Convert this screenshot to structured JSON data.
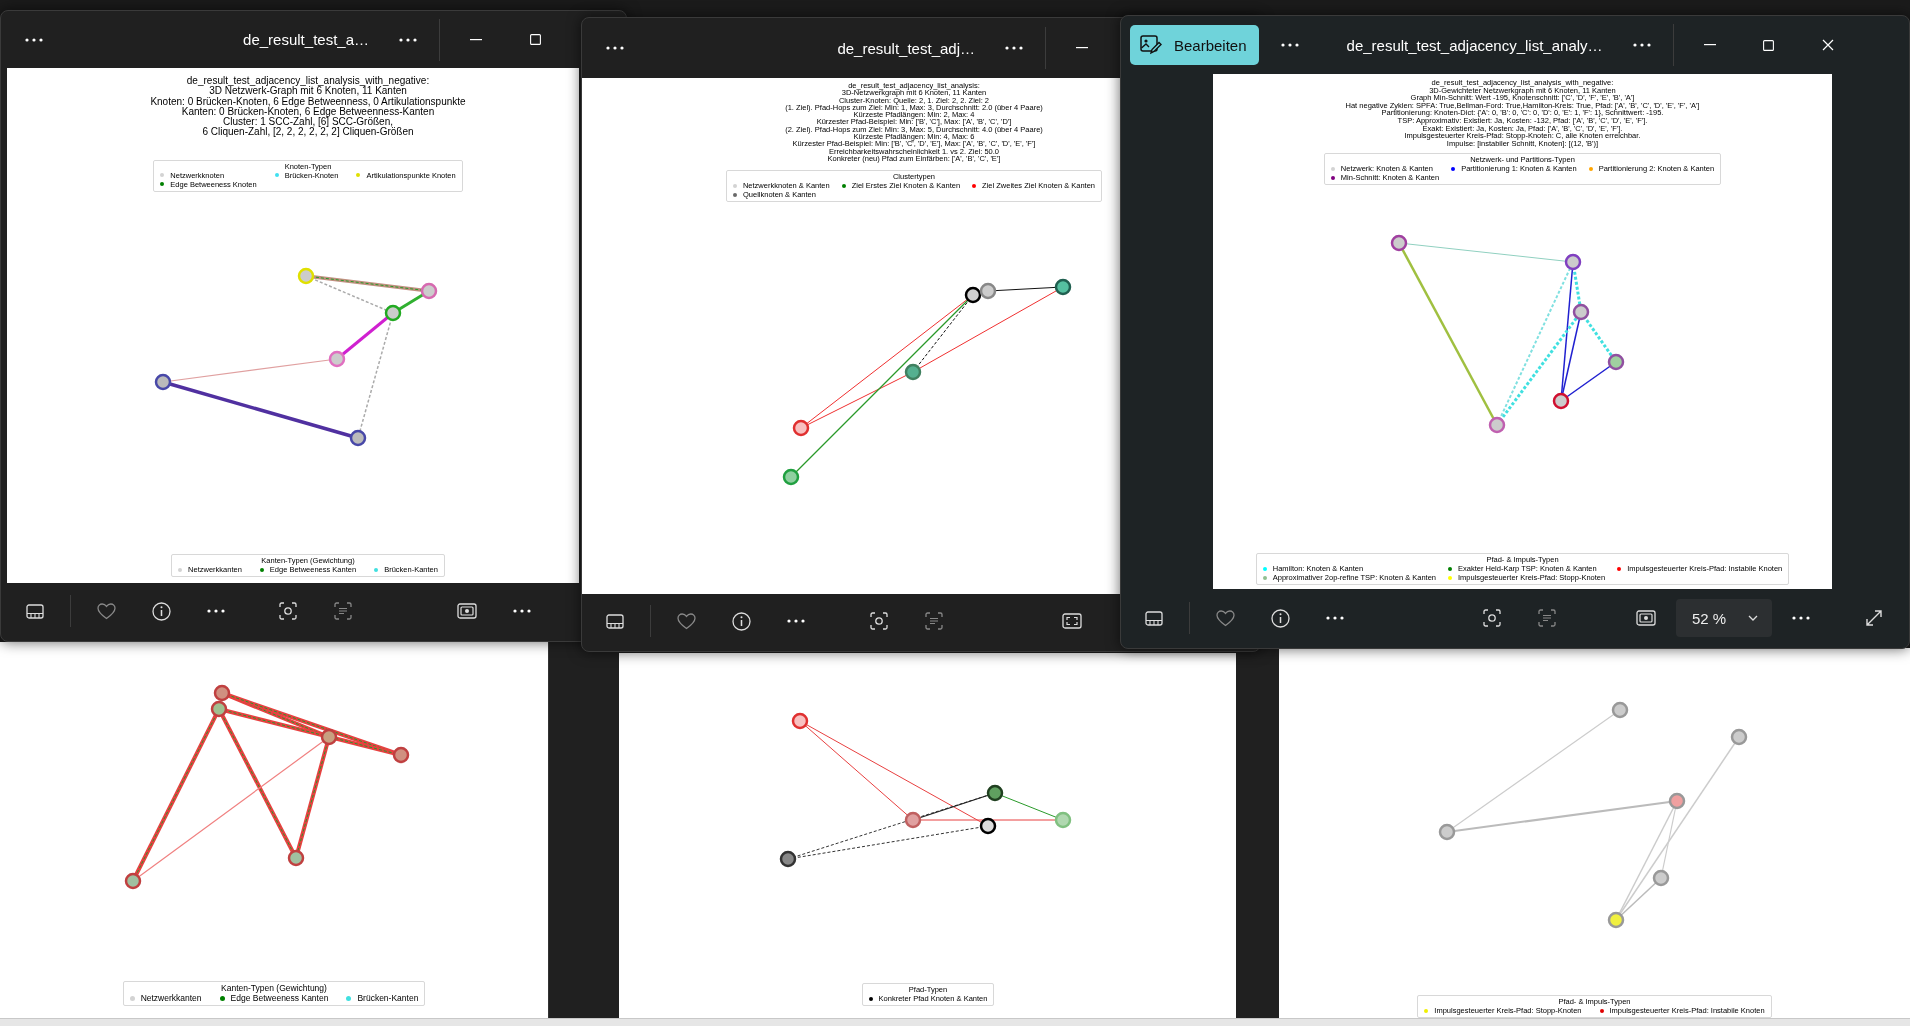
{
  "windows": [
    {
      "kind": "back",
      "menu": false,
      "figure": {
        "bottom_legend": {
          "title": "Kanten-Typen (Gewichtung)",
          "items": [
            {
              "label": "Netzwerkkanten",
              "color": "#d3d3d3"
            },
            {
              "label": "Edge Betweeness Kanten",
              "color": "#008000"
            },
            {
              "label": "Brücken-Kanten",
              "color": "#40e0e0"
            }
          ]
        }
      }
    },
    {
      "kind": "back",
      "menu": true,
      "figure": {
        "bottom_legend": {
          "title": "Pfad-Typen",
          "items": [
            {
              "label": "Konkreter Pfad Knoten & Kanten",
              "color": "#000000"
            }
          ]
        }
      }
    },
    {
      "kind": "back",
      "menu": false,
      "figure": {
        "bottom_legend": {
          "title": "Pfad- & Impuls-Typen",
          "items": [
            {
              "label": "Impulsgesteuerter Kreis-Pfad: Stopp-Knoten",
              "color": "#f0f000"
            },
            {
              "label": "Impulsgesteuerter Kreis-Pfad: Instabile Knoten",
              "color": "#e00000"
            }
          ]
        }
      }
    },
    {
      "kind": "front",
      "title": "de_result_test_a…",
      "controls": [
        {
          "kind": "minimize"
        },
        {
          "kind": "maximize"
        }
      ],
      "toolbar": [
        {
          "kind": "filmstrip"
        },
        {
          "kind": "divider"
        },
        {
          "kind": "heart"
        },
        {
          "kind": "info"
        },
        {
          "kind": "more"
        },
        {
          "kind": "scan"
        },
        {
          "kind": "textscan"
        },
        {
          "kind": "slideshow"
        },
        {
          "kind": "more"
        }
      ],
      "figure": {
        "title_lines": [
          "de_result_test_adjacency_list_analysis_with_negative:",
          "3D Netzwerk-Graph mit 6 Knoten, 11 Kanten",
          "Knoten: 0 Brücken-Knoten, 6 Edge Betweenness, 0 Artikulationspunkte",
          "Kanten: 0 Brücken-Knoten, 6 Edge Betweenness-Kanten",
          "Cluster: 1 SCC-Zahl, [6] SCC-Größen,",
          "6 Cliquen-Zahl, [2, 2, 2, 2, 2, 2] Cliquen-Größen"
        ],
        "top_legend": {
          "title": "Knoten-Typen",
          "items": [
            {
              "label": "Netzwerkknoten",
              "color": "#d3d3d3"
            },
            {
              "label": "Brücken-Knoten",
              "color": "#40e0f0"
            },
            {
              "label": "Artikulationspunkte Knoten",
              "color": "#e0e000"
            },
            {
              "label": "Edge Betweeness Knoten",
              "color": "#008000"
            }
          ]
        },
        "bottom_legend": {
          "title": "Kanten-Typen (Gewichtung)",
          "items": [
            {
              "label": "Netzwerkkanten",
              "color": "#d3d3d3"
            },
            {
              "label": "Edge Betweeness Kanten",
              "color": "#008000"
            },
            {
              "label": "Brücken-Kanten",
              "color": "#40e0e0"
            }
          ]
        }
      }
    },
    {
      "kind": "front",
      "title": "de_result_test_adj…",
      "controls": [
        {
          "kind": "minimize"
        }
      ],
      "toolbar": [
        {
          "kind": "filmstrip"
        },
        {
          "kind": "divider"
        },
        {
          "kind": "heart"
        },
        {
          "kind": "info"
        },
        {
          "kind": "more"
        },
        {
          "kind": "scan"
        },
        {
          "kind": "textscan"
        },
        {
          "kind": "fit"
        }
      ],
      "figure": {
        "title_lines": [
          "de_result_test_adjacency_list_analysis:",
          "3D-Netzwerkgraph mit 6 Knoten, 11 Kanten",
          "Cluster-Knoten: Quelle: 2, 1. Ziel: 2, 2. Ziel: 2",
          "(1. Ziel). Pfad-Hops zum Ziel: Min: 1, Max: 3, Durchschnitt: 2.0 (über 4 Paare)",
          "Kürzeste Pfadlängen: Min: 2, Max: 4",
          "Kürzester Pfad-Beispiel: Min: ['B', 'C'], Max: ['A', 'B', 'C', 'D']",
          "(2. Ziel). Pfad-Hops zum Ziel: Min: 3, Max: 5, Durchschnitt: 4.0 (über 4 Paare)",
          "Kürzeste Pfadlängen: Min: 4, Max: 6",
          "Kürzester Pfad-Beispiel: Min: ['B', 'C', 'D', 'E'], Max: ['A', 'B', 'C', 'D', 'E', 'F']",
          "Erreichbarkeitswahrscheinlichkeit 1. vs 2. Ziel: 50.0",
          "Konkreter (neu) Pfad zum Einfärben: ['A', 'B', 'C', 'E']"
        ],
        "top_legend": {
          "title": "Clustertypen",
          "items": [
            {
              "label": "Netzwerkknoten & Kanten",
              "color": "#d3d3d3"
            },
            {
              "label": "Ziel Erstes Ziel Knoten & Kanten",
              "color": "#008000"
            },
            {
              "label": "Ziel Zweites Ziel Knoten & Kanten",
              "color": "#ff0000"
            },
            {
              "label": "Quellknoten & Kanten",
              "color": "#696969"
            }
          ]
        }
      }
    },
    {
      "kind": "front",
      "title": "de_result_test_adjacency_list_analy…",
      "edit_button": "Bearbeiten",
      "controls": [
        {
          "kind": "minimize"
        },
        {
          "kind": "maximize"
        },
        {
          "kind": "close"
        }
      ],
      "toolbar": [
        {
          "kind": "filmstrip"
        },
        {
          "kind": "divider"
        },
        {
          "kind": "heart"
        },
        {
          "kind": "info"
        },
        {
          "kind": "more"
        },
        {
          "kind": "scan"
        },
        {
          "kind": "textscan"
        },
        {
          "kind": "slideshow"
        },
        {
          "kind": "zoom",
          "value": "52 %"
        },
        {
          "kind": "more"
        },
        {
          "kind": "expand"
        }
      ],
      "figure": {
        "title_lines": [
          "de_result_test_adjacency_list_analysis_with_negative:",
          "3D-Gewichteter Netzwerkgraph mit 6 Knoten, 11 Kanten",
          "Graph Min-Schnitt: Wert -195, Knotenschnitt: ['C', 'D', 'F', 'E', 'B', 'A']",
          "Hat negative Zyklen: SPFA: True,Bellman-Ford: True,Hamilton-Kreis: True, Pfad: ['A', 'B', 'C', 'D', 'E', 'F', 'A']",
          "Partitionierung: Knoten-Dict: {'A': 0, 'B': 0, 'C': 0, 'D': 0, 'E': 1, 'F': 1}, Schnittwert: -195.",
          "TSP: Approximativ: Existiert: Ja, Kosten: -132, Pfad: ['A', 'B', 'C', 'D', 'E', 'F'].",
          "Exakt: Existiert: Ja, Kosten: Ja, Pfad: ['A', 'B', 'C', 'D', 'E', 'F'].",
          "Impulsgesteuerter Kreis-Pfad: Stopp-Knoten: C, alle Knoten erreichbar.",
          "Impulse: [instabiler Schnitt, Knoten]: [(12, 'B')]"
        ],
        "top_legend": {
          "title": "Netzwerk- und Partitions-Typen",
          "items": [
            {
              "label": "Netzwerk: Knoten & Kanten",
              "color": "#d3d3d3"
            },
            {
              "label": "Partitionierung 1: Knoten & Kanten",
              "color": "#0000ff"
            },
            {
              "label": "Partitionierung 2: Knoten & Kanten",
              "color": "#ffa500"
            },
            {
              "label": "Min-Schnitt: Knoten & Kanten",
              "color": "#800080"
            }
          ]
        },
        "bottom_legend": {
          "title": "Pfad- & Impuls-Typen",
          "items": [
            {
              "label": "Hamilton: Knoten & Kanten",
              "color": "#00ffff"
            },
            {
              "label": "Exakter Held-Karp TSP: Knoten & Kanten",
              "color": "#008000"
            },
            {
              "label": "Impulsgesteuerter Kreis-Pfad: Instabile Knoten",
              "color": "#ff0000"
            },
            {
              "label": "Approximativer 2op-refine TSP: Knoten & Kanten",
              "color": "#90c090"
            },
            {
              "label": "Impulsgesteuerter Kreis-Pfad: Stopp-Knoten",
              "color": "#ffff00"
            }
          ]
        }
      }
    }
  ]
}
